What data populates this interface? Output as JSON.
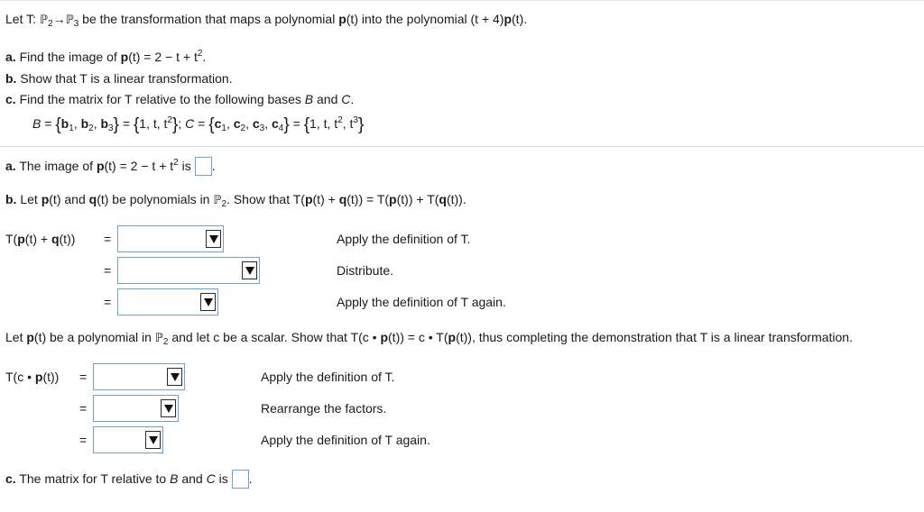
{
  "intro": {
    "prefix": "Let T: ",
    "domain_space": "ℙ",
    "domain_sub": "2",
    "arrow": "→",
    "codomain_space": "ℙ",
    "codomain_sub": "3",
    "text1": " be the transformation that maps a polynomial ",
    "p_bold": "p",
    "text2": "(t) into the polynomial (t + 4)",
    "p_bold2": "p",
    "text3": "(t)."
  },
  "parts": {
    "a": {
      "label": "a.",
      "text1": " Find the image of ",
      "p_bold": "p",
      "text2": "(t) = 2 − t + t",
      "exp": "2",
      "text3": "."
    },
    "b": {
      "label": "b.",
      "text": " Show that T is a linear transformation."
    },
    "c": {
      "label": "c.",
      "text1": " Find the matrix for T relative to the following bases ",
      "B": "B",
      "and": " and ",
      "C": "C",
      "text2": "."
    }
  },
  "bases": {
    "B": "B",
    "eq1": " = ",
    "b1": "b",
    "s1": "1",
    "b2": "b",
    "s2": "2",
    "b3": "b",
    "s3": "3",
    "comma": ", ",
    "eq2": " = ",
    "one": "1, t, t",
    "exp2": "2",
    "semicolon": "; ",
    "C": "C",
    "eq3": " = ",
    "c1": "c",
    "cs1": "1",
    "c2": "c",
    "cs2": "2",
    "c3": "c",
    "cs3": "3",
    "c4": "c",
    "cs4": "4",
    "eq4": " = ",
    "cone": "1, t, t",
    "cexp2": "2",
    "cmid": ", t",
    "cexp3": "3"
  },
  "answer_a": {
    "label": "a.",
    "text1": " The image of ",
    "p_bold": "p",
    "text2": "(t) = 2 − t + t",
    "exp": "2",
    "text3": " is",
    "after": "."
  },
  "answer_b": {
    "label": "b.",
    "text1": " Let ",
    "p_bold": "p",
    "text2": "(t) and ",
    "q_bold": "q",
    "text3": "(t) be polynomials in ",
    "space": "ℙ",
    "sub": "2",
    "text4": ". Show that T(",
    "p2": "p",
    "text5": "(t) + ",
    "q2": "q",
    "text6": "(t)) = T(",
    "p3": "p",
    "text7": "(t)) + T(",
    "q3": "q",
    "text8": "(t))."
  },
  "additivity": {
    "lhs_pre": "T(",
    "lhs_p": "p",
    "lhs_mid": "(t) + ",
    "lhs_q": "q",
    "lhs_post": "(t))",
    "eq": "=",
    "rows": [
      {
        "note": "Apply the definition of T."
      },
      {
        "note": "Distribute."
      },
      {
        "note": "Apply the definition of T again."
      }
    ]
  },
  "scalar_intro": {
    "text1": "Let ",
    "p_bold": "p",
    "text2": "(t) be a polynomial in ",
    "space": "ℙ",
    "sub": "2",
    "text3": " and let c be a scalar. Show that T(c • ",
    "p2": "p",
    "text4": "(t)) = c • T(",
    "p3": "p",
    "text5": "(t)), thus completing the demonstration that T is a linear transformation."
  },
  "homogeneity": {
    "lhs_pre": "T(c • ",
    "lhs_p": "p",
    "lhs_post": "(t))",
    "eq": "=",
    "rows": [
      {
        "note": "Apply the definition of T."
      },
      {
        "note": "Rearrange the factors."
      },
      {
        "note": "Apply the definition of T again."
      }
    ]
  },
  "answer_c": {
    "label": "c.",
    "text1": " The matrix for T relative to ",
    "B": "B",
    "and": " and ",
    "C": "C",
    "text2": " is",
    "after": "."
  }
}
